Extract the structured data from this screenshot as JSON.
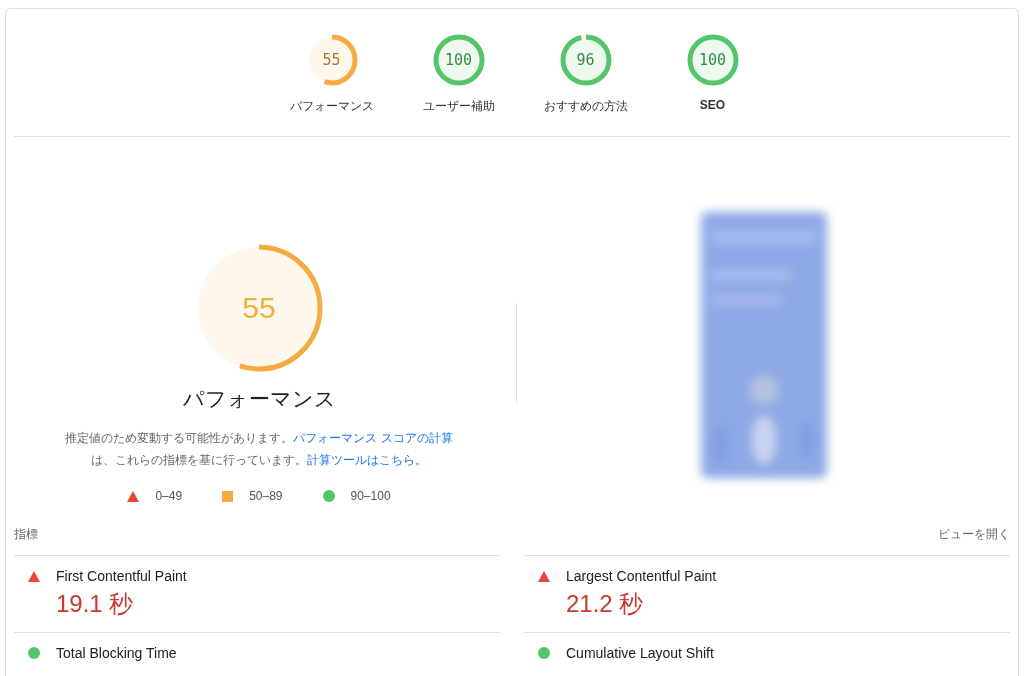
{
  "categories": [
    {
      "score": "55",
      "label": "パフォーマンス",
      "color": "#f4ab42",
      "bold": false
    },
    {
      "score": "100",
      "label": "ユーザー補助",
      "color": "#55c56c",
      "bold": false
    },
    {
      "score": "96",
      "label": "おすすめの方法",
      "color": "#55c56c",
      "bold": false
    },
    {
      "score": "100",
      "label": "SEO",
      "color": "#55c56c",
      "bold": true
    }
  ],
  "main_gauge": {
    "score": "55",
    "title": "パフォーマンス",
    "color": "#f4ab42"
  },
  "description": {
    "text": "推定値のため変動する可能性があります。",
    "link1": "パフォーマンス スコアの計算",
    "text2": "は、これらの指標を基に行っています。",
    "link2": "計算ツールはこちら。"
  },
  "legend": [
    {
      "kind": "triangle",
      "color": "#eb4335",
      "label": "0–49"
    },
    {
      "kind": "square",
      "color": "#f4ab42",
      "label": "50–89"
    },
    {
      "kind": "circle",
      "color": "#55c56c",
      "label": "90–100"
    }
  ],
  "metrics_header": {
    "title": "指標",
    "toggle": "ビューを開く"
  },
  "metrics": [
    {
      "name": "First Contentful Paint",
      "value": "19.1 秒",
      "kind": "triangle",
      "color": "#eb4335"
    },
    {
      "name": "Largest Contentful Paint",
      "value": "21.2 秒",
      "kind": "triangle",
      "color": "#eb4335"
    },
    {
      "name": "Total Blocking Time",
      "kind": "circle",
      "color": "#55c56c"
    },
    {
      "name": "Cumulative Layout Shift",
      "kind": "circle",
      "color": "#55c56c"
    }
  ]
}
